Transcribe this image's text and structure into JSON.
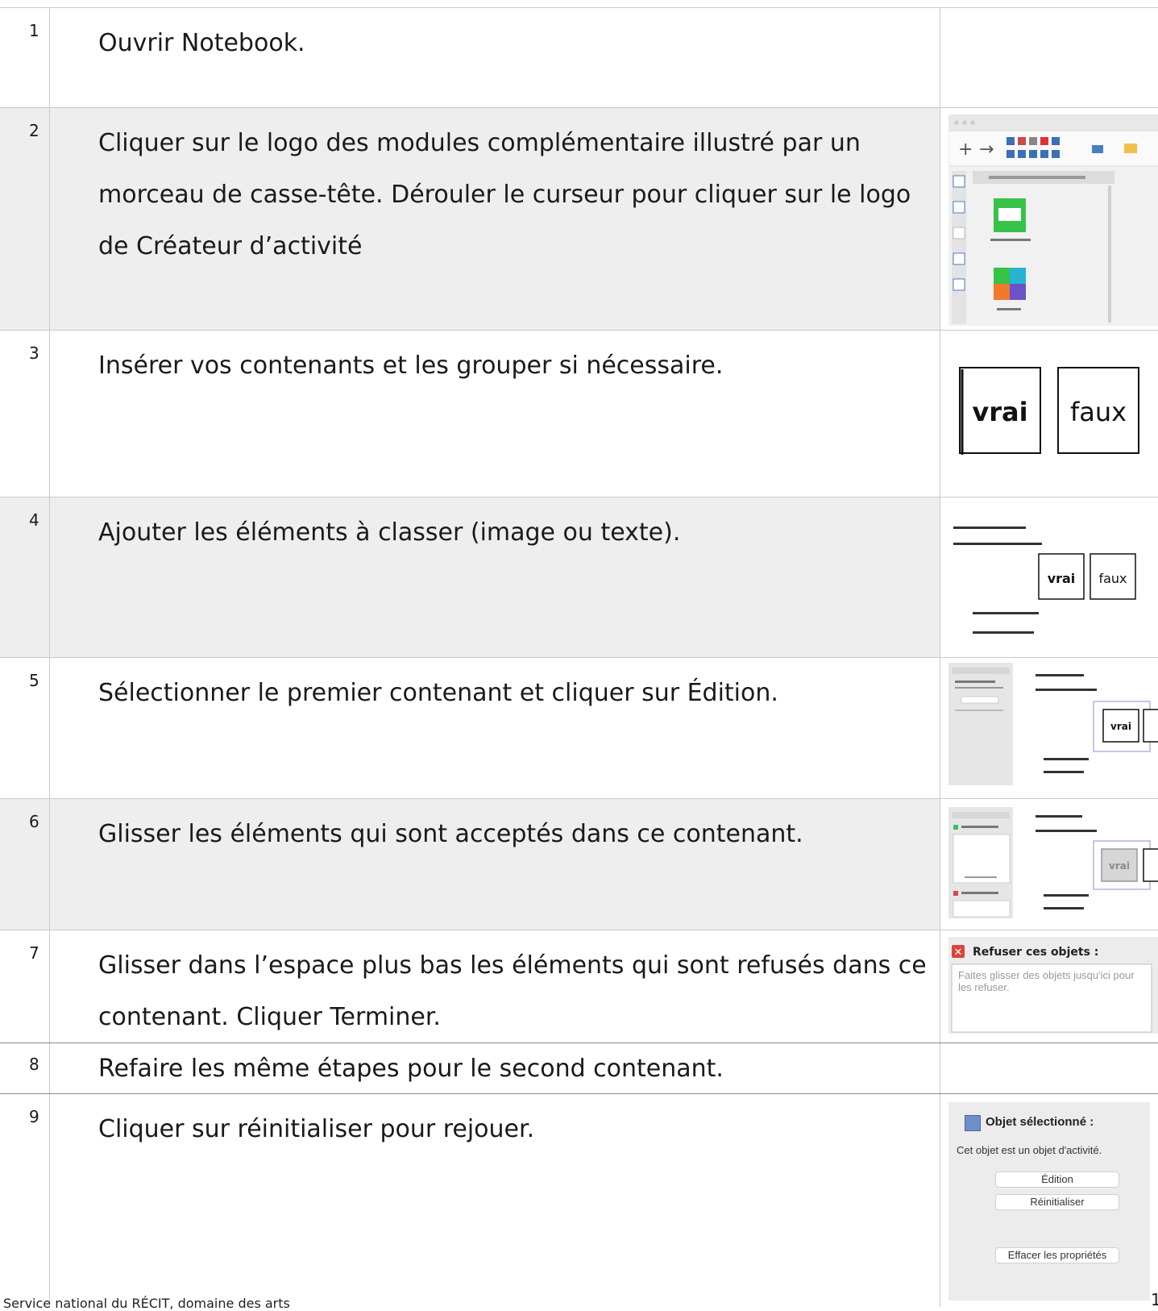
{
  "steps": [
    {
      "num": "1",
      "text": "Ouvrir Notebook."
    },
    {
      "num": "2",
      "text": "Cliquer sur le logo des modules complémentaire illustré par un morceau de casse-tête. Dérouler le curseur  pour cliquer sur le logo de Créateur d’activité"
    },
    {
      "num": "3",
      "text": "Insérer vos contenants et les grouper si nécessaire."
    },
    {
      "num": "4",
      "text": "Ajouter les éléments à classer (image ou texte)."
    },
    {
      "num": "5",
      "text": "Sélectionner le premier contenant et cliquer sur Édition."
    },
    {
      "num": "6",
      "text": "Glisser les éléments qui sont acceptés dans ce contenant."
    },
    {
      "num": "7",
      "text": "Glisser dans l’espace plus bas les éléments qui sont refusés dans ce contenant. Cliquer Terminer."
    },
    {
      "num": "8",
      "text": "Refaire les même étapes pour le second contenant."
    },
    {
      "num": "9",
      "text": "Cliquer sur réinitialiser pour rejouer."
    }
  ],
  "images": {
    "container_labels": [
      "vrai",
      "faux"
    ],
    "refuse_panel": {
      "title": "Refuser ces objets :",
      "hint": "Faites glisser des objets jusqu'ici pour les refuser."
    },
    "selected_panel": {
      "title": "Objet sélectionné :",
      "description": "Cet objet est un objet d'activité.",
      "buttons": [
        "Édition",
        "Réinitialiser",
        "Effacer les propriétés"
      ]
    }
  },
  "footer": {
    "text": "Service national du RÉCIT, domaine des arts",
    "page": "1"
  }
}
